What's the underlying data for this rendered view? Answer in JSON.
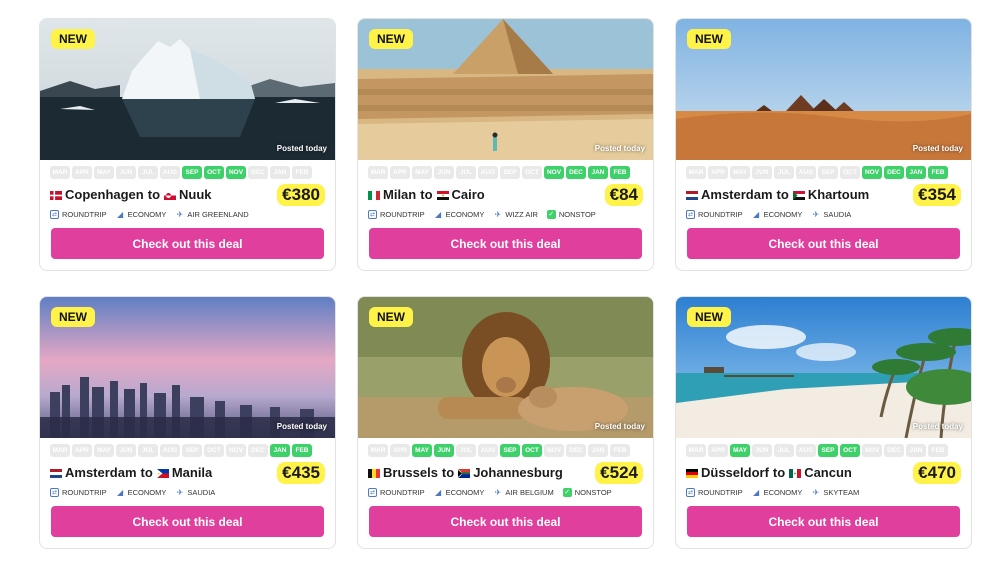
{
  "months": [
    "MAR",
    "APR",
    "MAY",
    "JUN",
    "JUL",
    "AUG",
    "SEP",
    "OCT",
    "NOV",
    "DEC",
    "JAN",
    "FEB"
  ],
  "cards": [
    {
      "badge": "NEW",
      "posted": "Posted today",
      "scene": "iceberg",
      "active_months": [
        "SEP",
        "OCT",
        "NOV"
      ],
      "origin": "Copenhagen",
      "to": "to",
      "destination": "Nuuk",
      "origin_flag": "dk",
      "destination_flag": "gl",
      "price": "€380",
      "tags": [
        {
          "icon": "roundtrip-icon",
          "label": "ROUNDTRIP"
        },
        {
          "icon": "seat-icon",
          "label": "ECONOMY"
        },
        {
          "icon": "plane-icon",
          "label": "AIR GREENLAND"
        }
      ],
      "cta": "Check out this deal"
    },
    {
      "badge": "NEW",
      "posted": "Posted today",
      "scene": "pyramid",
      "active_months": [
        "NOV",
        "DEC",
        "JAN",
        "FEB"
      ],
      "origin": "Milan",
      "to": "to",
      "destination": "Cairo",
      "origin_flag": "it",
      "destination_flag": "eg",
      "price": "€84",
      "tags": [
        {
          "icon": "roundtrip-icon",
          "label": "ROUNDTRIP"
        },
        {
          "icon": "seat-icon",
          "label": "ECONOMY"
        },
        {
          "icon": "plane-icon",
          "label": "WIZZ AIR"
        },
        {
          "icon": "check-icon",
          "label": "NONSTOP"
        }
      ],
      "cta": "Check out this deal"
    },
    {
      "badge": "NEW",
      "posted": "Posted today",
      "scene": "desert",
      "active_months": [
        "NOV",
        "DEC",
        "JAN",
        "FEB"
      ],
      "origin": "Amsterdam",
      "to": "to",
      "destination": "Khartoum",
      "origin_flag": "nl",
      "destination_flag": "sd",
      "price": "€354",
      "tags": [
        {
          "icon": "roundtrip-icon",
          "label": "ROUNDTRIP"
        },
        {
          "icon": "seat-icon",
          "label": "ECONOMY"
        },
        {
          "icon": "plane-icon",
          "label": "SAUDIA"
        }
      ],
      "cta": "Check out this deal"
    },
    {
      "badge": "NEW",
      "posted": "Posted today",
      "scene": "city",
      "active_months": [
        "JAN",
        "FEB"
      ],
      "origin": "Amsterdam",
      "to": "to",
      "destination": "Manila",
      "origin_flag": "nl",
      "destination_flag": "ph",
      "price": "€435",
      "tags": [
        {
          "icon": "roundtrip-icon",
          "label": "ROUNDTRIP"
        },
        {
          "icon": "seat-icon",
          "label": "ECONOMY"
        },
        {
          "icon": "plane-icon",
          "label": "SAUDIA"
        }
      ],
      "cta": "Check out this deal"
    },
    {
      "badge": "NEW",
      "posted": "Posted today",
      "scene": "lion",
      "active_months": [
        "MAY",
        "JUN",
        "SEP",
        "OCT"
      ],
      "origin": "Brussels",
      "to": "to",
      "destination": "Johannesburg",
      "origin_flag": "be",
      "destination_flag": "za",
      "price": "€524",
      "tags": [
        {
          "icon": "roundtrip-icon",
          "label": "ROUNDTRIP"
        },
        {
          "icon": "seat-icon",
          "label": "ECONOMY"
        },
        {
          "icon": "plane-icon",
          "label": "AIR BELGIUM"
        },
        {
          "icon": "check-icon",
          "label": "NONSTOP"
        }
      ],
      "cta": "Check out this deal"
    },
    {
      "badge": "NEW",
      "posted": "Posted today",
      "scene": "beach",
      "active_months": [
        "MAY",
        "SEP",
        "OCT"
      ],
      "origin": "Düsseldorf",
      "to": "to",
      "destination": "Cancun",
      "origin_flag": "de",
      "destination_flag": "mx",
      "price": "€470",
      "tags": [
        {
          "icon": "roundtrip-icon",
          "label": "ROUNDTRIP"
        },
        {
          "icon": "seat-icon",
          "label": "ECONOMY"
        },
        {
          "icon": "plane-icon",
          "label": "SKYTEAM"
        }
      ],
      "cta": "Check out this deal"
    }
  ],
  "colors": {
    "badge": "#fff34a",
    "cta": "#e03f9e",
    "month_on": "#3ed16a",
    "month_off": "#e9e9e9"
  }
}
